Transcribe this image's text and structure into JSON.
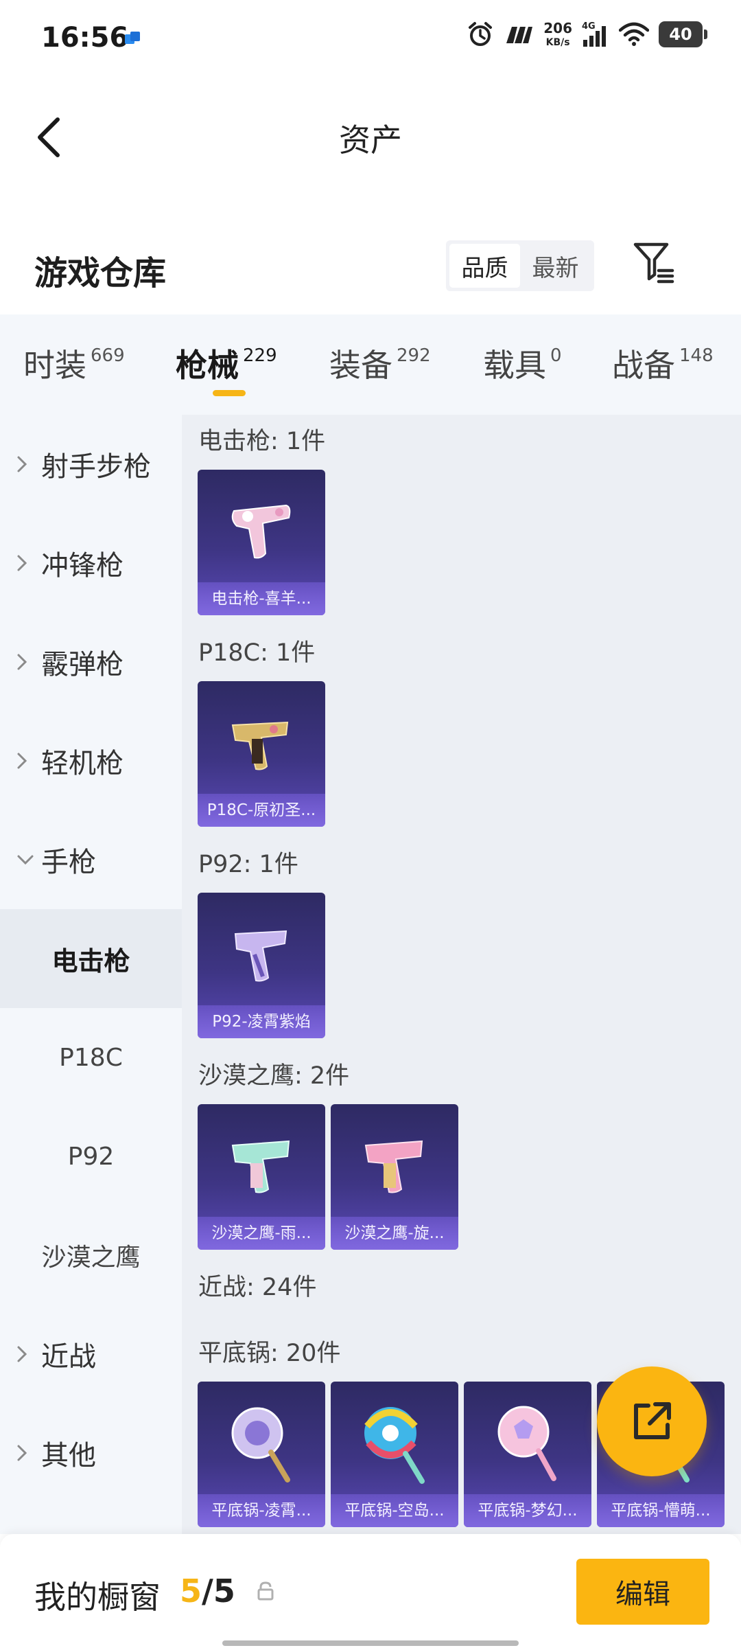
{
  "status_bar": {
    "time": "16:56",
    "net_speed": "206",
    "net_unit": "KB/s",
    "network": "4G",
    "battery": "40",
    "icons": [
      "app-notification-icon",
      "alarm-icon",
      "signal-icon",
      "wifi-icon",
      "battery-icon"
    ]
  },
  "header": {
    "title": "资产",
    "back_icon": "back-arrow-icon"
  },
  "section": {
    "title": "游戏仓库",
    "sort_options": [
      "品质",
      "最新"
    ],
    "filter_icon": "filter-icon"
  },
  "tabs": [
    {
      "label": "时装",
      "count": "669"
    },
    {
      "label": "枪械",
      "count": "229"
    },
    {
      "label": "装备",
      "count": "292"
    },
    {
      "label": "载具",
      "count": "0"
    },
    {
      "label": "战备",
      "count": "148"
    }
  ],
  "sidebar": {
    "items": [
      {
        "label": "射手步枪"
      },
      {
        "label": "冲锋枪"
      },
      {
        "label": "霰弹枪"
      },
      {
        "label": "轻机枪"
      },
      {
        "label": "手枪"
      }
    ],
    "sub_items": [
      {
        "label": "电击枪"
      },
      {
        "label": "P18C"
      },
      {
        "label": "P92"
      },
      {
        "label": "沙漠之鹰"
      }
    ],
    "items_after": [
      {
        "label": "近战"
      },
      {
        "label": "其他"
      }
    ]
  },
  "groups": [
    {
      "title": "电击枪: 1件",
      "items": [
        {
          "name": "电击枪-喜羊..."
        }
      ]
    },
    {
      "title": "P18C: 1件",
      "items": [
        {
          "name": "P18C-原初圣..."
        }
      ]
    },
    {
      "title": "P92: 1件",
      "items": [
        {
          "name": "P92-凌霄紫焰"
        }
      ]
    },
    {
      "title": "沙漠之鹰: 2件",
      "items": [
        {
          "name": "沙漠之鹰-雨..."
        },
        {
          "name": "沙漠之鹰-旋..."
        }
      ]
    },
    {
      "title": "近战: 24件",
      "items": []
    },
    {
      "title": "平底锅: 20件",
      "items": [
        {
          "name": "平底锅-凌霄..."
        },
        {
          "name": "平底锅-空岛..."
        },
        {
          "name": "平底锅-梦幻..."
        },
        {
          "name": "平底锅-懵萌..."
        }
      ]
    }
  ],
  "bottom": {
    "window_label": "我的橱窗",
    "count_current": "5",
    "count_sep": "/",
    "count_total": "5",
    "edit_label": "编辑",
    "share_icon": "share-icon",
    "lock_icon": "lock-icon"
  },
  "colors": {
    "accent": "#fbb511",
    "card": "#3e3584",
    "sidebar": "#f4f7fb",
    "content": "#eceff4"
  }
}
